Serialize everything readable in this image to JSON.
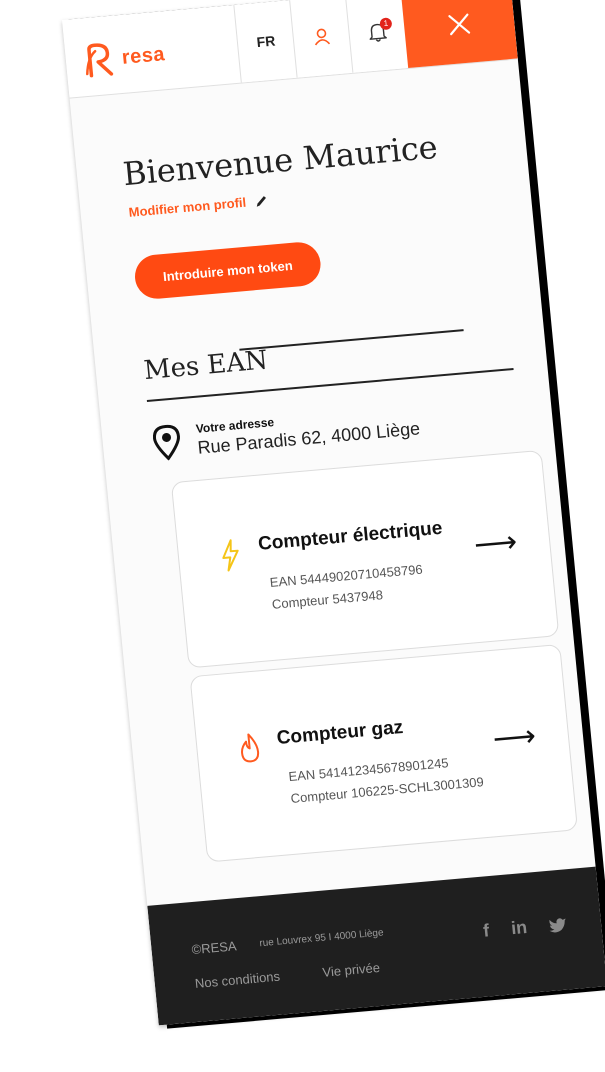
{
  "header": {
    "logo_text": "resa",
    "lang": "FR",
    "notifications_count": "1",
    "icons": [
      "user-icon",
      "bell-icon",
      "close-icon"
    ],
    "accent": "#ff5a1f"
  },
  "main": {
    "welcome": "Bienvenue Maurice",
    "edit_profile": "Modifier mon profil",
    "token_button": "Introduire mon token",
    "section_title": "Mes EAN",
    "address_label": "Votre adresse",
    "address_value": "Rue Paradis 62, 4000 Liège"
  },
  "meters": [
    {
      "title": "Compteur électrique",
      "ean": "EAN 544490207104587​96",
      "number": "Compteur 5437948",
      "icon": "lightning-icon",
      "icon_color": "#f5c518"
    },
    {
      "title": "Compteur gaz",
      "ean": "EAN 541412345678901245",
      "number": "Compteur 106225-SCHL3001309",
      "icon": "flame-icon",
      "icon_color": "#ff5a1f"
    }
  ],
  "footer": {
    "copyright": "©RESA",
    "address": "rue Louvrex 95 I 4000 Liège",
    "conditions": "Nos conditions",
    "privacy": "Vie privée",
    "social": [
      "f",
      "in",
      "twitter-icon"
    ]
  }
}
